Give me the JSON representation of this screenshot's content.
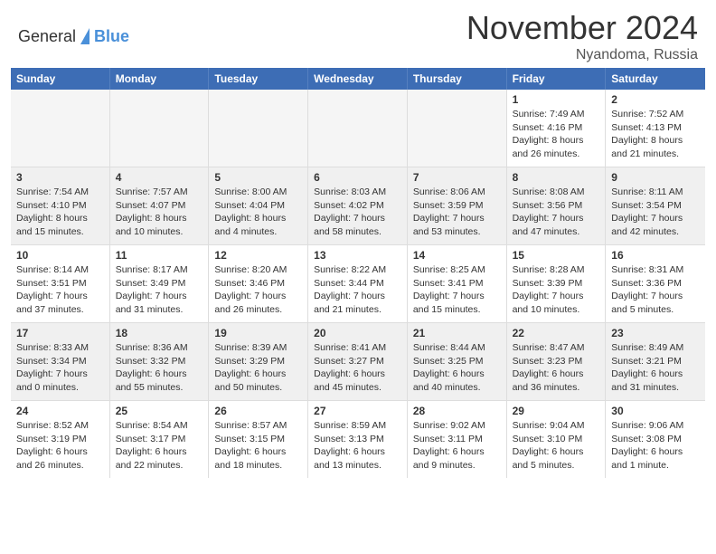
{
  "header": {
    "logo": {
      "general": "General",
      "blue": "Blue",
      "alt": "GeneralBlue logo"
    },
    "title": "November 2024",
    "location": "Nyandoma, Russia"
  },
  "calendar": {
    "days_of_week": [
      "Sunday",
      "Monday",
      "Tuesday",
      "Wednesday",
      "Thursday",
      "Friday",
      "Saturday"
    ],
    "weeks": [
      {
        "cells": [
          {
            "day": "",
            "empty": true
          },
          {
            "day": "",
            "empty": true
          },
          {
            "day": "",
            "empty": true
          },
          {
            "day": "",
            "empty": true
          },
          {
            "day": "",
            "empty": true
          },
          {
            "day": "1",
            "sunrise": "Sunrise: 7:49 AM",
            "sunset": "Sunset: 4:16 PM",
            "daylight": "Daylight: 8 hours and 26 minutes."
          },
          {
            "day": "2",
            "sunrise": "Sunrise: 7:52 AM",
            "sunset": "Sunset: 4:13 PM",
            "daylight": "Daylight: 8 hours and 21 minutes."
          }
        ]
      },
      {
        "cells": [
          {
            "day": "3",
            "sunrise": "Sunrise: 7:54 AM",
            "sunset": "Sunset: 4:10 PM",
            "daylight": "Daylight: 8 hours and 15 minutes."
          },
          {
            "day": "4",
            "sunrise": "Sunrise: 7:57 AM",
            "sunset": "Sunset: 4:07 PM",
            "daylight": "Daylight: 8 hours and 10 minutes."
          },
          {
            "day": "5",
            "sunrise": "Sunrise: 8:00 AM",
            "sunset": "Sunset: 4:04 PM",
            "daylight": "Daylight: 8 hours and 4 minutes."
          },
          {
            "day": "6",
            "sunrise": "Sunrise: 8:03 AM",
            "sunset": "Sunset: 4:02 PM",
            "daylight": "Daylight: 7 hours and 58 minutes."
          },
          {
            "day": "7",
            "sunrise": "Sunrise: 8:06 AM",
            "sunset": "Sunset: 3:59 PM",
            "daylight": "Daylight: 7 hours and 53 minutes."
          },
          {
            "day": "8",
            "sunrise": "Sunrise: 8:08 AM",
            "sunset": "Sunset: 3:56 PM",
            "daylight": "Daylight: 7 hours and 47 minutes."
          },
          {
            "day": "9",
            "sunrise": "Sunrise: 8:11 AM",
            "sunset": "Sunset: 3:54 PM",
            "daylight": "Daylight: 7 hours and 42 minutes."
          }
        ]
      },
      {
        "cells": [
          {
            "day": "10",
            "sunrise": "Sunrise: 8:14 AM",
            "sunset": "Sunset: 3:51 PM",
            "daylight": "Daylight: 7 hours and 37 minutes."
          },
          {
            "day": "11",
            "sunrise": "Sunrise: 8:17 AM",
            "sunset": "Sunset: 3:49 PM",
            "daylight": "Daylight: 7 hours and 31 minutes."
          },
          {
            "day": "12",
            "sunrise": "Sunrise: 8:20 AM",
            "sunset": "Sunset: 3:46 PM",
            "daylight": "Daylight: 7 hours and 26 minutes."
          },
          {
            "day": "13",
            "sunrise": "Sunrise: 8:22 AM",
            "sunset": "Sunset: 3:44 PM",
            "daylight": "Daylight: 7 hours and 21 minutes."
          },
          {
            "day": "14",
            "sunrise": "Sunrise: 8:25 AM",
            "sunset": "Sunset: 3:41 PM",
            "daylight": "Daylight: 7 hours and 15 minutes."
          },
          {
            "day": "15",
            "sunrise": "Sunrise: 8:28 AM",
            "sunset": "Sunset: 3:39 PM",
            "daylight": "Daylight: 7 hours and 10 minutes."
          },
          {
            "day": "16",
            "sunrise": "Sunrise: 8:31 AM",
            "sunset": "Sunset: 3:36 PM",
            "daylight": "Daylight: 7 hours and 5 minutes."
          }
        ]
      },
      {
        "cells": [
          {
            "day": "17",
            "sunrise": "Sunrise: 8:33 AM",
            "sunset": "Sunset: 3:34 PM",
            "daylight": "Daylight: 7 hours and 0 minutes."
          },
          {
            "day": "18",
            "sunrise": "Sunrise: 8:36 AM",
            "sunset": "Sunset: 3:32 PM",
            "daylight": "Daylight: 6 hours and 55 minutes."
          },
          {
            "day": "19",
            "sunrise": "Sunrise: 8:39 AM",
            "sunset": "Sunset: 3:29 PM",
            "daylight": "Daylight: 6 hours and 50 minutes."
          },
          {
            "day": "20",
            "sunrise": "Sunrise: 8:41 AM",
            "sunset": "Sunset: 3:27 PM",
            "daylight": "Daylight: 6 hours and 45 minutes."
          },
          {
            "day": "21",
            "sunrise": "Sunrise: 8:44 AM",
            "sunset": "Sunset: 3:25 PM",
            "daylight": "Daylight: 6 hours and 40 minutes."
          },
          {
            "day": "22",
            "sunrise": "Sunrise: 8:47 AM",
            "sunset": "Sunset: 3:23 PM",
            "daylight": "Daylight: 6 hours and 36 minutes."
          },
          {
            "day": "23",
            "sunrise": "Sunrise: 8:49 AM",
            "sunset": "Sunset: 3:21 PM",
            "daylight": "Daylight: 6 hours and 31 minutes."
          }
        ]
      },
      {
        "cells": [
          {
            "day": "24",
            "sunrise": "Sunrise: 8:52 AM",
            "sunset": "Sunset: 3:19 PM",
            "daylight": "Daylight: 6 hours and 26 minutes."
          },
          {
            "day": "25",
            "sunrise": "Sunrise: 8:54 AM",
            "sunset": "Sunset: 3:17 PM",
            "daylight": "Daylight: 6 hours and 22 minutes."
          },
          {
            "day": "26",
            "sunrise": "Sunrise: 8:57 AM",
            "sunset": "Sunset: 3:15 PM",
            "daylight": "Daylight: 6 hours and 18 minutes."
          },
          {
            "day": "27",
            "sunrise": "Sunrise: 8:59 AM",
            "sunset": "Sunset: 3:13 PM",
            "daylight": "Daylight: 6 hours and 13 minutes."
          },
          {
            "day": "28",
            "sunrise": "Sunrise: 9:02 AM",
            "sunset": "Sunset: 3:11 PM",
            "daylight": "Daylight: 6 hours and 9 minutes."
          },
          {
            "day": "29",
            "sunrise": "Sunrise: 9:04 AM",
            "sunset": "Sunset: 3:10 PM",
            "daylight": "Daylight: 6 hours and 5 minutes."
          },
          {
            "day": "30",
            "sunrise": "Sunrise: 9:06 AM",
            "sunset": "Sunset: 3:08 PM",
            "daylight": "Daylight: 6 hours and 1 minute."
          }
        ]
      }
    ]
  }
}
